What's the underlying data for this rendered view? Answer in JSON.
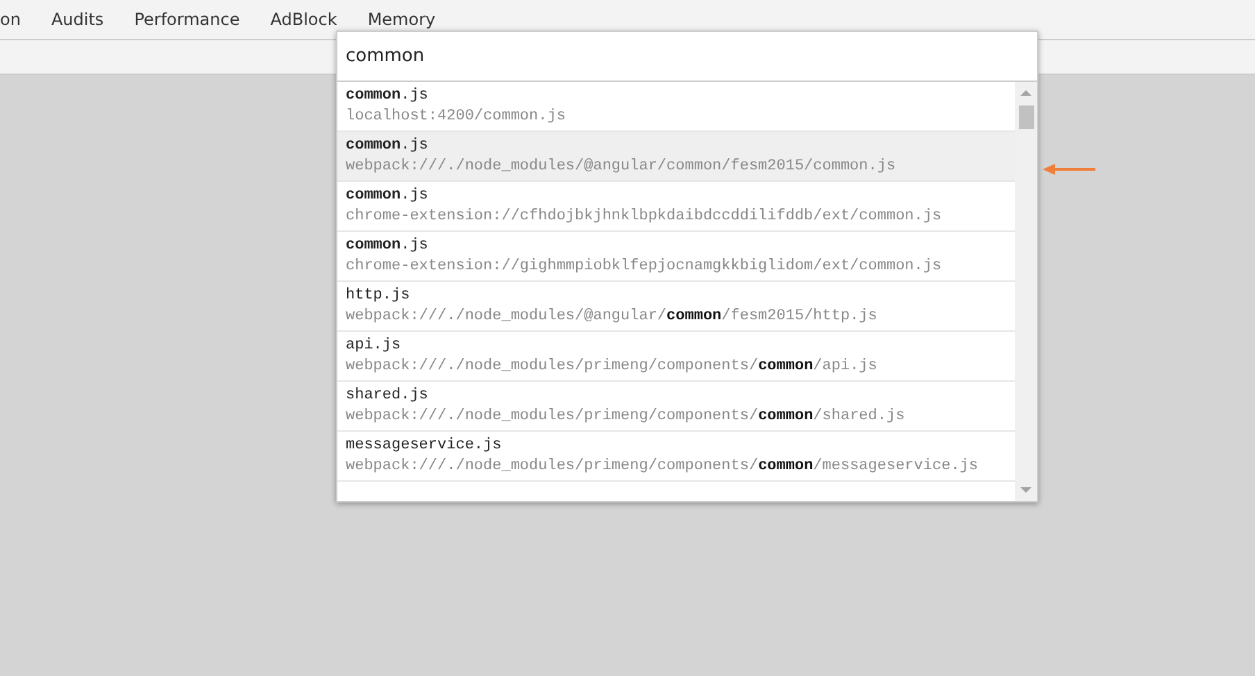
{
  "tabs": [
    "on",
    "Audits",
    "Performance",
    "AdBlock",
    "Memory"
  ],
  "search": {
    "value": "common"
  },
  "results": [
    {
      "name": "**common**.js",
      "path": "localhost:4200/common.js",
      "selected": false
    },
    {
      "name": "**common**.js",
      "path": "webpack:///./node_modules/@angular/common/fesm2015/common.js",
      "selected": true
    },
    {
      "name": "**common**.js",
      "path": "chrome-extension://cfhdojbkjhnklbpkdaibdccddilifddb/ext/common.js",
      "selected": false
    },
    {
      "name": "**common**.js",
      "path": "chrome-extension://gighmmpiobklfepjocnamgkkbiglidom/ext/common.js",
      "selected": false
    },
    {
      "name": "http.js",
      "path": "webpack:///./node_modules/@angular/**common**/fesm2015/http.js",
      "selected": false
    },
    {
      "name": "api.js",
      "path": "webpack:///./node_modules/primeng/components/**common**/api.js",
      "selected": false
    },
    {
      "name": "shared.js",
      "path": "webpack:///./node_modules/primeng/components/**common**/shared.js",
      "selected": false
    },
    {
      "name": "messageservice.js",
      "path": "webpack:///./node_modules/primeng/components/**common**/messageservice.js",
      "selected": false
    }
  ]
}
